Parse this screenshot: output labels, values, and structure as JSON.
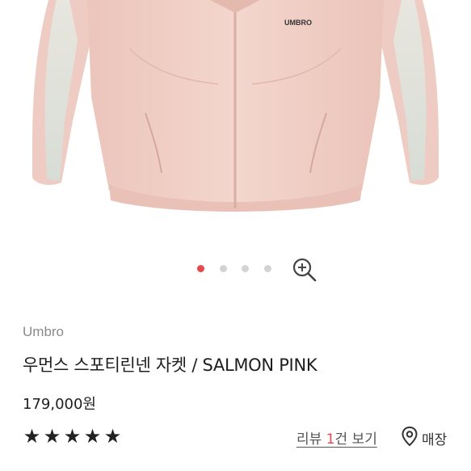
{
  "product": {
    "image_logo_text": "UMBRO",
    "brand": "Umbro",
    "title": "우먼스 스포티린넨 자켓 / SALMON PINK",
    "price": "179,000원"
  },
  "carousel": {
    "total": 4,
    "active_index": 0,
    "zoom_icon": "zoom-in-icon"
  },
  "rating": {
    "stars": 5,
    "star_icon": "star-icon"
  },
  "review": {
    "prefix": "리뷰 ",
    "count": "1",
    "suffix": "건 보기"
  },
  "store": {
    "icon": "location-pin-icon",
    "label": "매장"
  },
  "colors": {
    "accent": "#e5484d",
    "jacket": "#f0cfc6",
    "sleeve_stripe": "#dfe3dc"
  }
}
